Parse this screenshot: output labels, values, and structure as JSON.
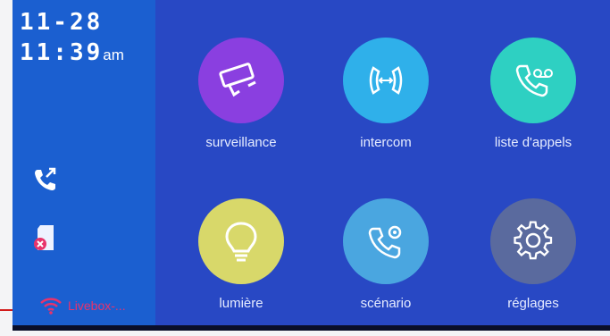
{
  "status": {
    "date": "11-28",
    "time": "11:39",
    "ampm": "am"
  },
  "sidebar": {
    "icons": [
      "call-transfer-icon",
      "sd-card-error-icon"
    ],
    "wifi": {
      "icon": "wifi-icon",
      "label": "Livebox-..."
    }
  },
  "menu": {
    "items": [
      {
        "label": "surveillance",
        "icon": "camera-icon"
      },
      {
        "label": "intercom",
        "icon": "intercom-icon"
      },
      {
        "label": "liste d'appels",
        "icon": "call-log-icon"
      },
      {
        "label": "lumière",
        "icon": "lightbulb-icon"
      },
      {
        "label": "scénario",
        "icon": "scenario-icon"
      },
      {
        "label": "réglages",
        "icon": "settings-icon"
      }
    ]
  },
  "colors": {
    "surveillance": "#8a3fe0",
    "intercom": "#2fb0ea",
    "liste_appels": "#2ed0c2",
    "lumiere": "#d8d86a",
    "scenario": "#4aa6e0",
    "reglages": "#5a6a9e",
    "wifi": "#e8336b"
  }
}
